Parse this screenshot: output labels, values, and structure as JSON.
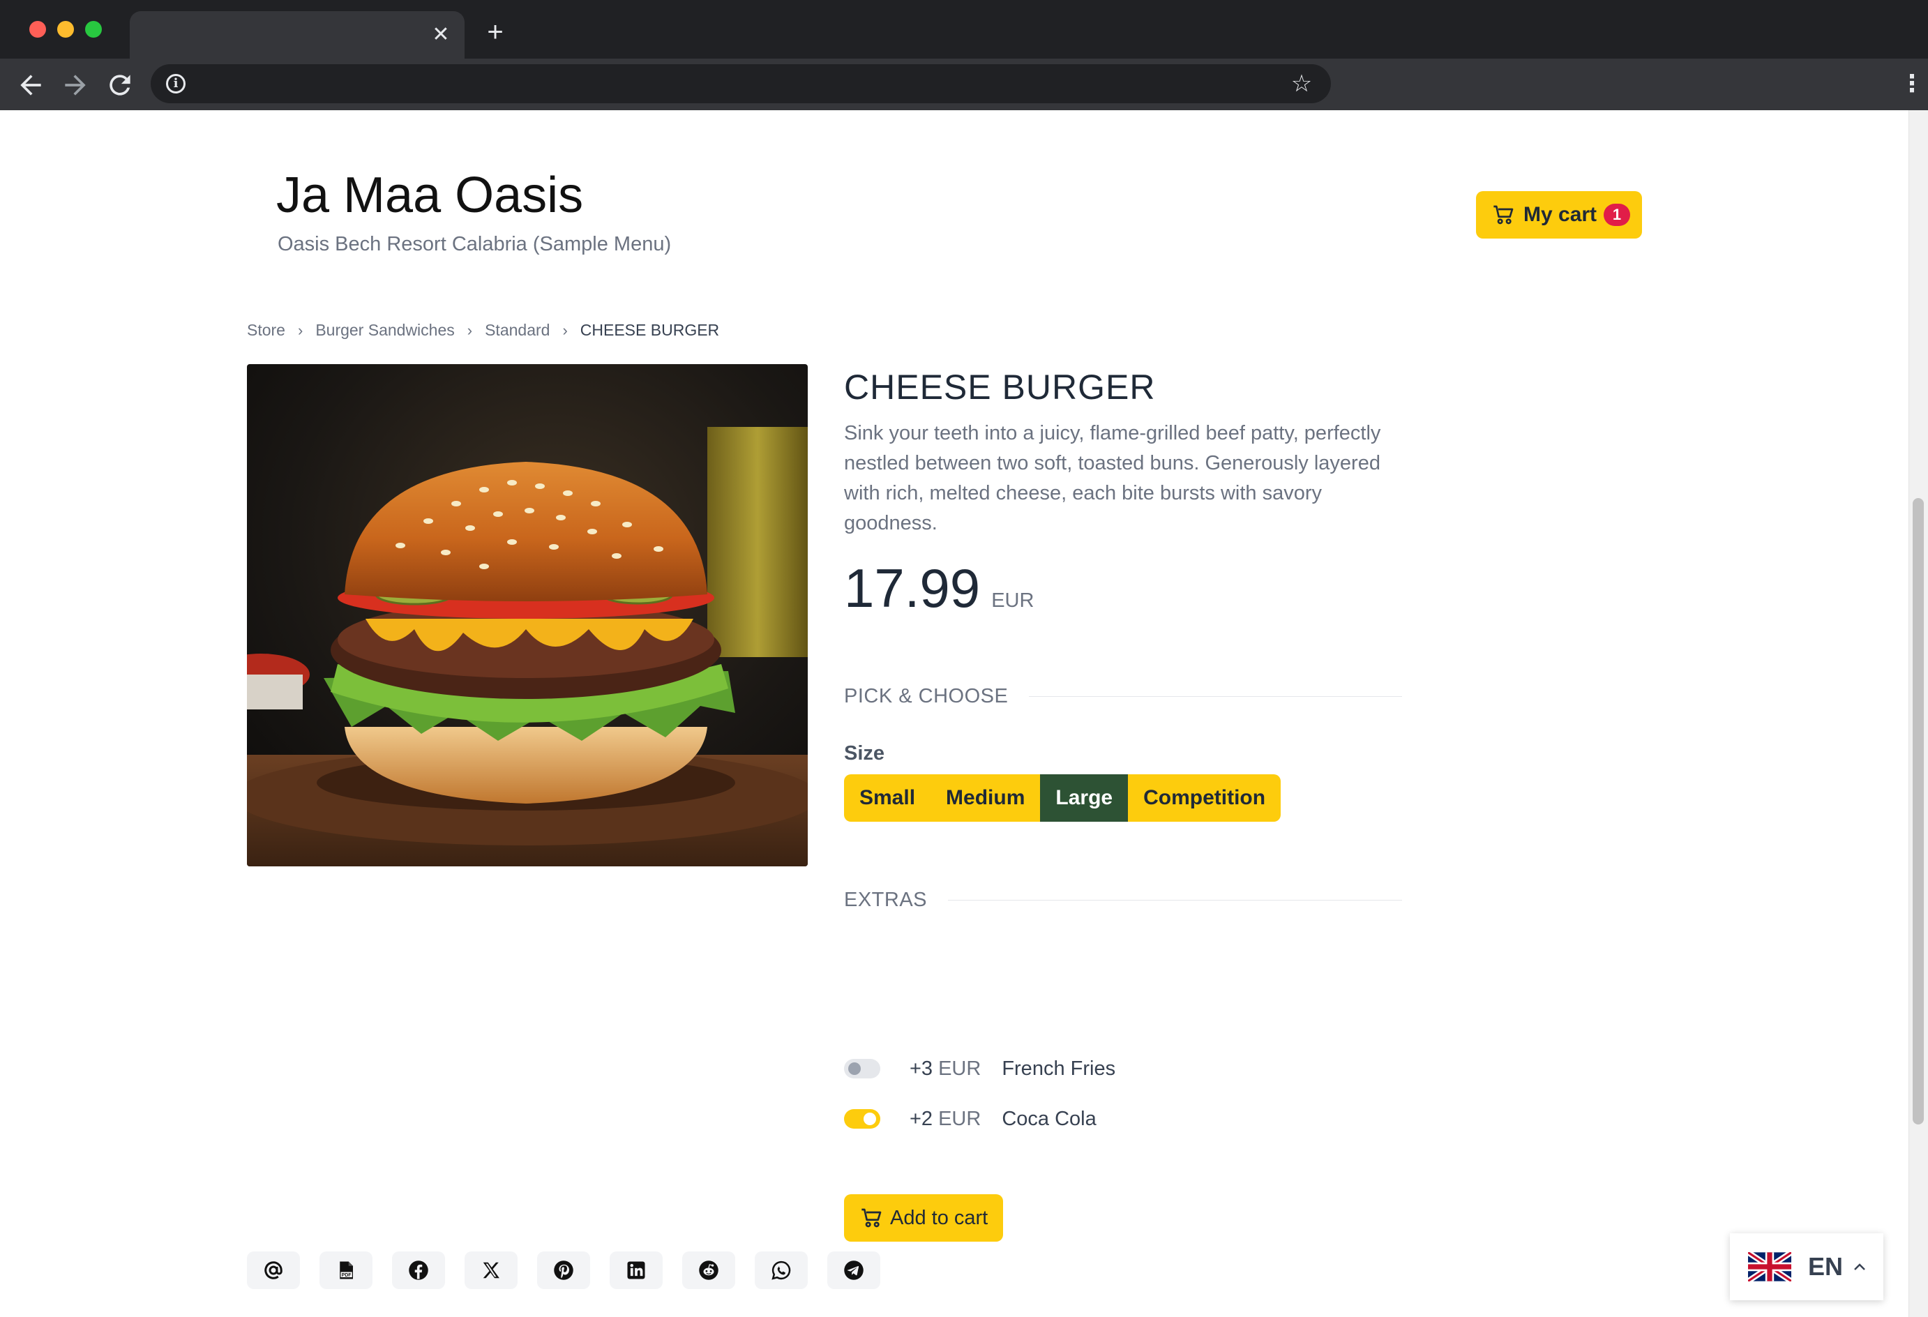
{
  "browser": {
    "tab_close": "✕",
    "new_tab": "+"
  },
  "header": {
    "title": "Ja Maa Oasis",
    "subtitle": "Oasis Bech Resort Calabria (Sample Menu)",
    "cart": {
      "label": "My cart",
      "count": "1"
    }
  },
  "breadcrumb": {
    "items": [
      "Store",
      "Burger Sandwiches",
      "Standard",
      "CHEESE BURGER"
    ],
    "separator": "›"
  },
  "product": {
    "name": "CHEESE BURGER",
    "description": "Sink your teeth into a juicy, flame-grilled beef patty, perfectly nestled between two soft, toasted buns. Generously layered with rich, melted cheese, each bite bursts with savory goodness.",
    "price": "17.99",
    "currency": "EUR"
  },
  "options": {
    "section_title": "PICK & CHOOSE",
    "size_label": "Size",
    "sizes": [
      "Small",
      "Medium",
      "Large",
      "Competition"
    ],
    "selected_size": "Large"
  },
  "extras": {
    "section_title": "EXTRAS",
    "items": [
      {
        "price": "+3",
        "currency": "EUR",
        "name": "French Fries",
        "enabled": false
      },
      {
        "price": "+2",
        "currency": "EUR",
        "name": "Coca Cola",
        "enabled": true
      }
    ]
  },
  "actions": {
    "add_to_cart": "Add to cart"
  },
  "share": {
    "icons": [
      "email-icon",
      "pdf-icon",
      "facebook-icon",
      "x-icon",
      "pinterest-icon",
      "linkedin-icon",
      "reddit-icon",
      "whatsapp-icon",
      "telegram-icon"
    ]
  },
  "language": {
    "code": "EN"
  },
  "colors": {
    "accent": "#fdcc0d",
    "selected": "#2d5234",
    "badge": "#e11d48"
  }
}
